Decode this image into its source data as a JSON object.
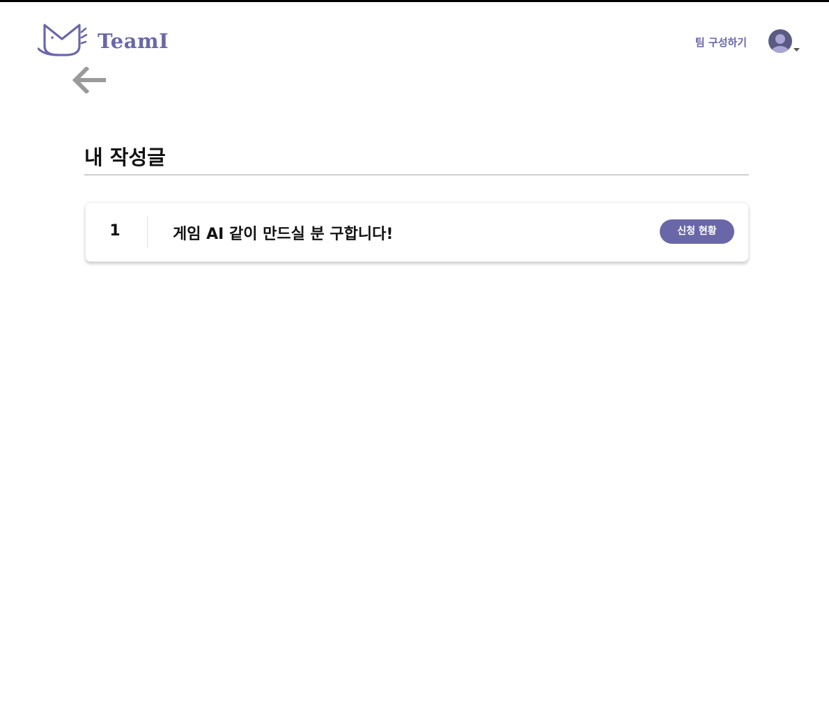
{
  "brand": {
    "name": "TeamI",
    "color": "#6a67a8"
  },
  "header": {
    "nav_link": "팀 구성하기",
    "avatar_icon": "user-avatar-icon",
    "dropdown_icon": "caret-down-icon"
  },
  "back": {
    "icon": "arrow-left-icon"
  },
  "page": {
    "title": "내 작성글"
  },
  "posts": [
    {
      "number": "1",
      "title": "게임 AI 같이 만드실 분 구합니다!",
      "action_label": "신청 현황"
    }
  ]
}
